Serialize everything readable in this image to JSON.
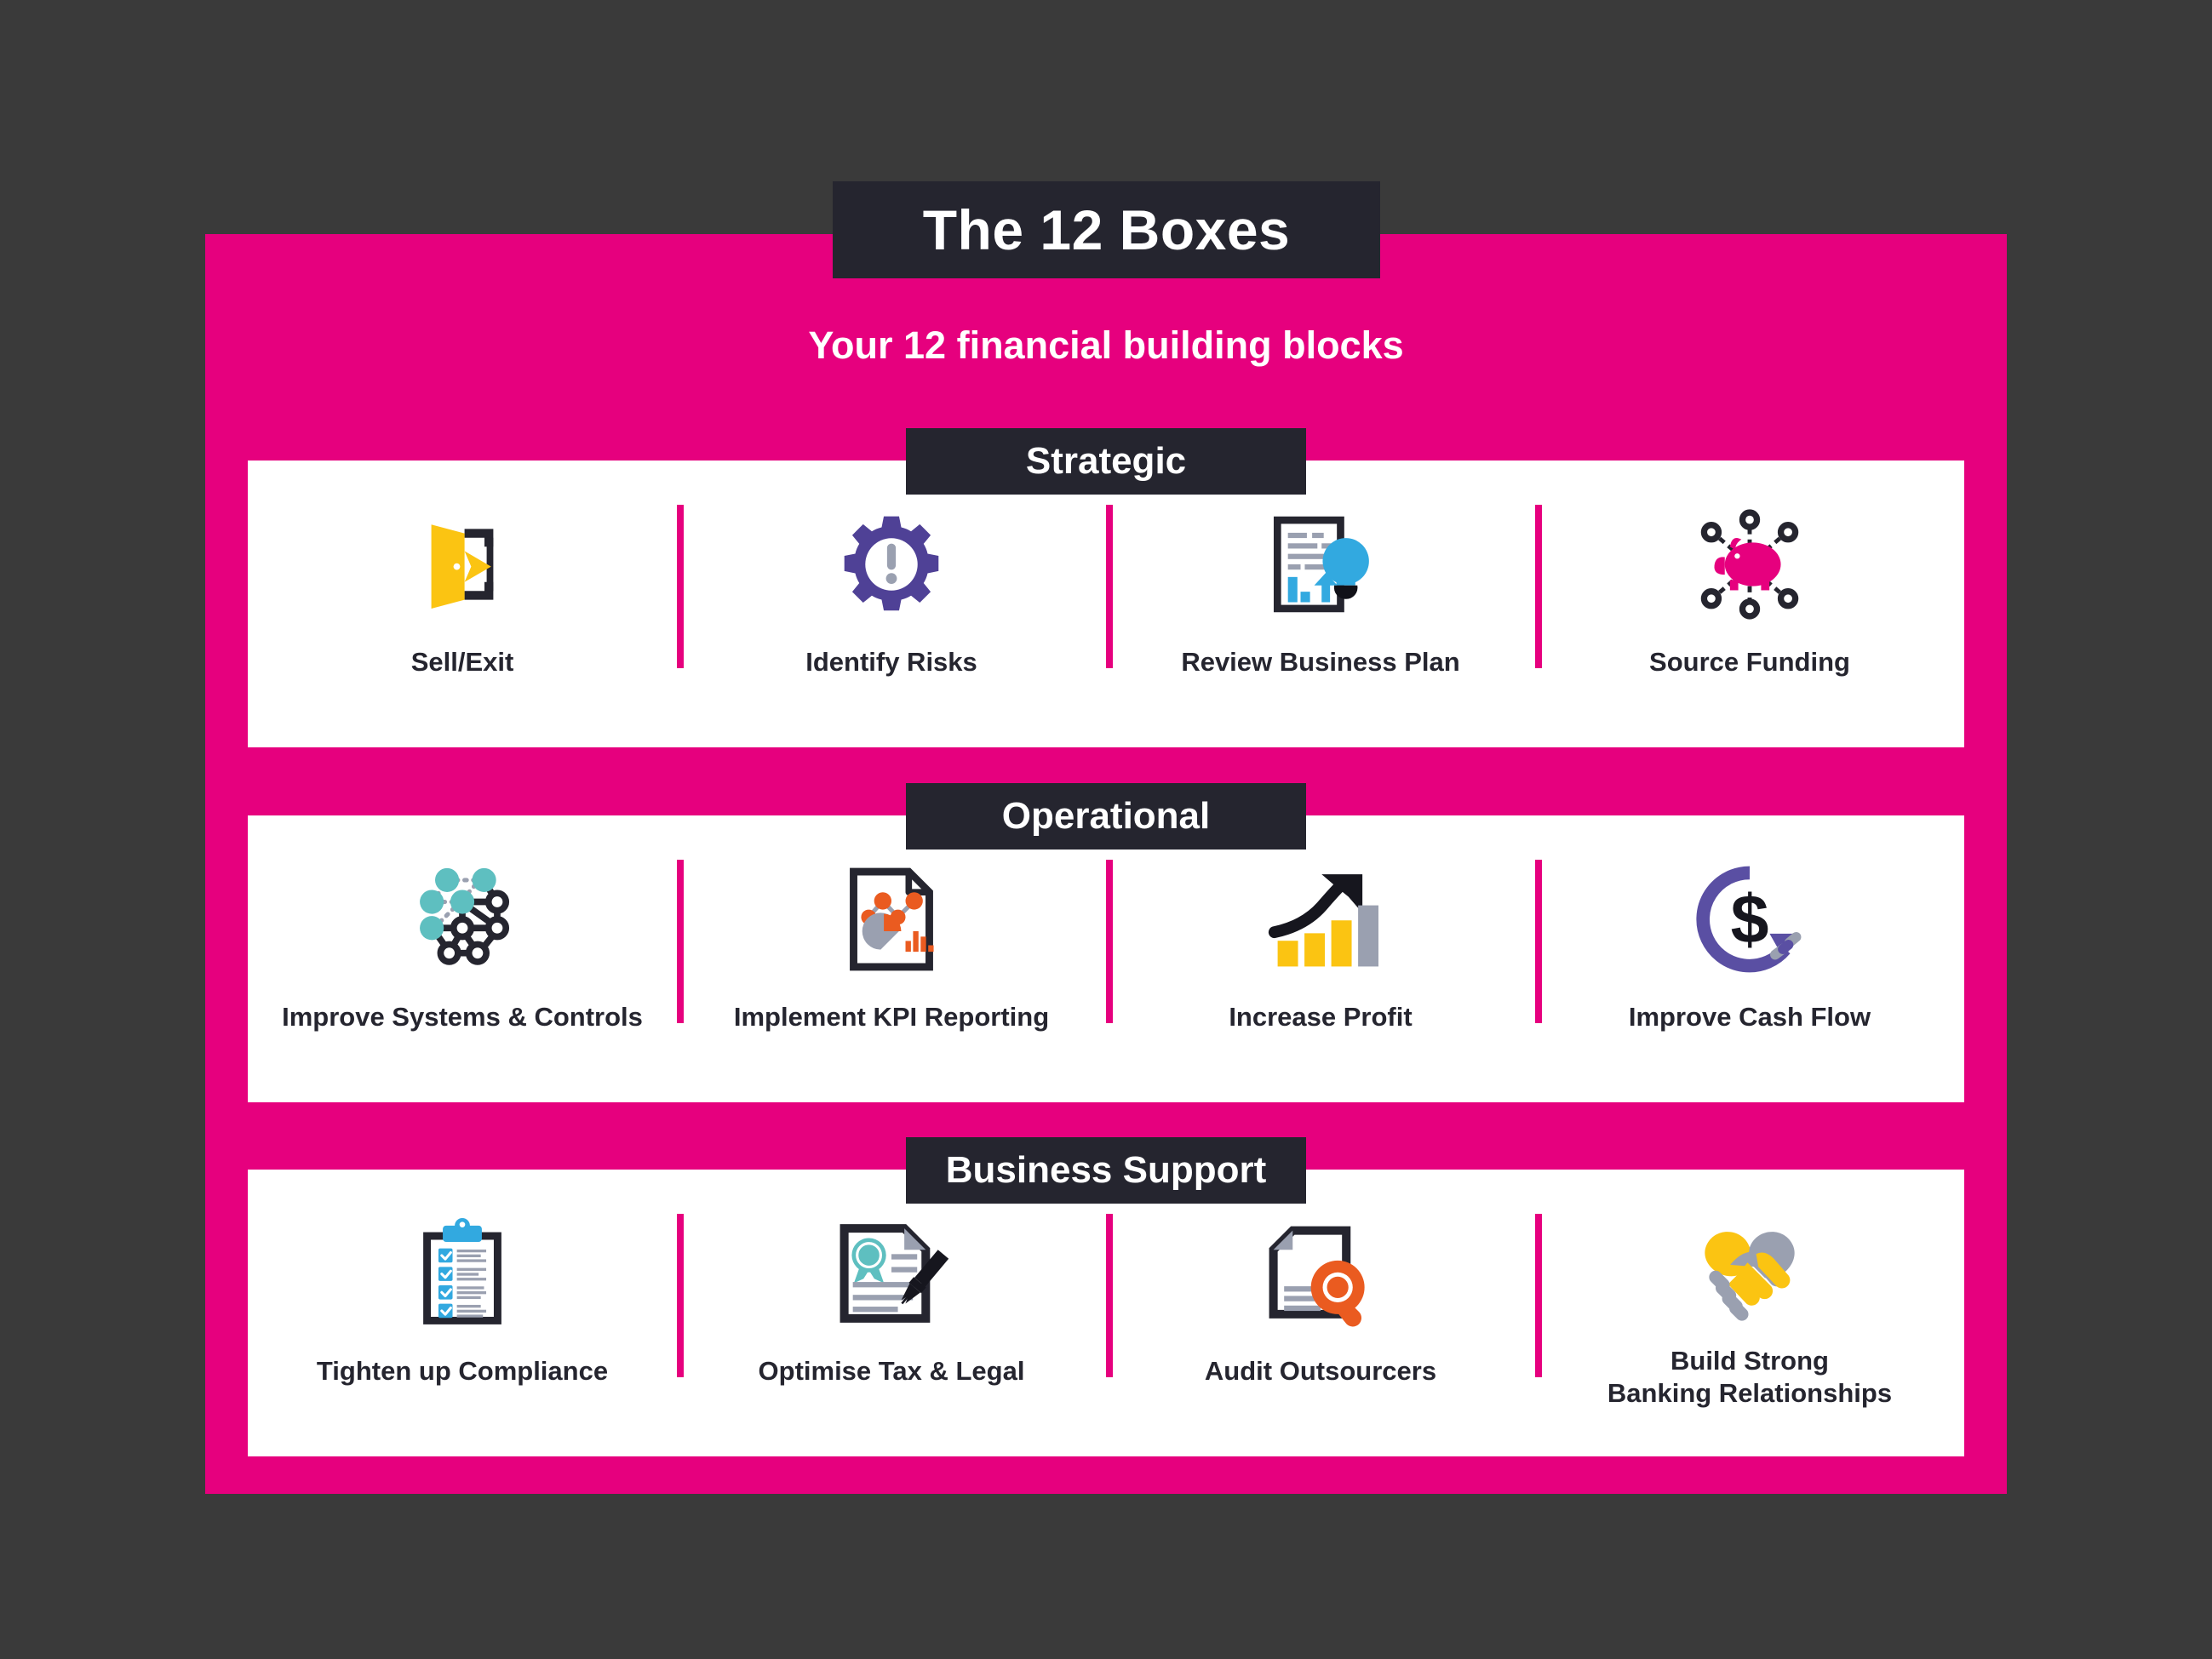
{
  "header": {
    "title": "The 12 Boxes",
    "subtitle": "Your 12 financial building blocks"
  },
  "colors": {
    "background": "#3a3a3a",
    "panel_pink": "#e6007e",
    "badge_dark": "#25252f",
    "card_white": "#ffffff",
    "label_text": "#25252f",
    "icon_yellow": "#fbc412",
    "icon_purple": "#4f4196",
    "icon_blue": "#32a9e0",
    "icon_teal": "#5ebfc0",
    "icon_orange": "#ea5b20",
    "icon_gray": "#9aa0b0",
    "icon_dark": "#25252f"
  },
  "sections": [
    {
      "title": "Strategic",
      "items": [
        {
          "label": "Sell/Exit",
          "icon": "open-door-exit-icon"
        },
        {
          "label": "Identify Risks",
          "icon": "gear-exclamation-icon"
        },
        {
          "label": "Review Business Plan",
          "icon": "document-chart-lightbulb-icon"
        },
        {
          "label": "Source Funding",
          "icon": "piggy-bank-network-icon"
        }
      ]
    },
    {
      "title": "Operational",
      "items": [
        {
          "label": "Improve Systems & Controls",
          "icon": "network-nodes-icon"
        },
        {
          "label": "Implement KPI Reporting",
          "icon": "document-analytics-icon"
        },
        {
          "label": "Increase Profit",
          "icon": "bar-chart-arrow-up-icon"
        },
        {
          "label": "Improve Cash Flow",
          "icon": "dollar-circular-arrow-icon"
        }
      ]
    },
    {
      "title": "Business Support",
      "items": [
        {
          "label": "Tighten up Compliance",
          "icon": "clipboard-checklist-icon"
        },
        {
          "label": "Optimise Tax & Legal",
          "icon": "certificate-pen-icon"
        },
        {
          "label": "Audit Outsourcers",
          "icon": "document-magnifier-icon"
        },
        {
          "label": "Build Strong\nBanking Relationships",
          "icon": "handshake-heart-icon"
        }
      ]
    }
  ]
}
